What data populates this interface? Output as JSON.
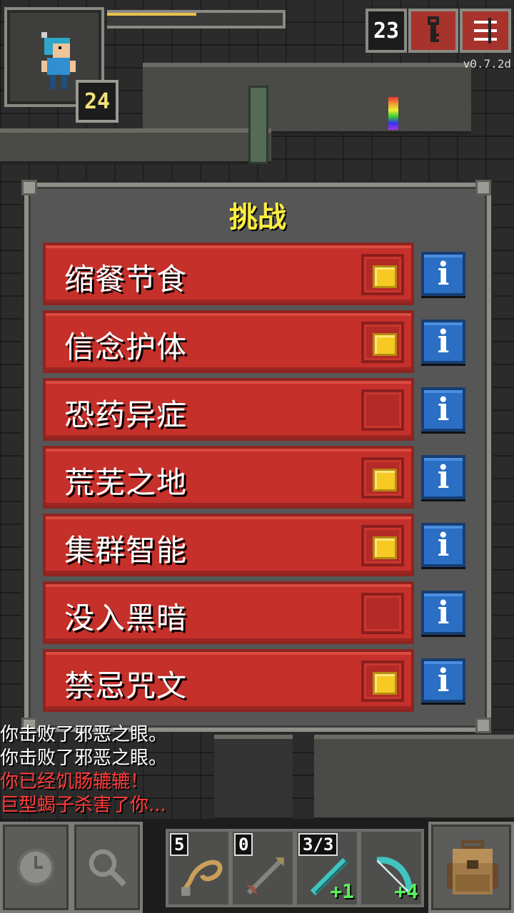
{
  "hud": {
    "hero_level": "24",
    "hp_fraction": 0.51,
    "depth": "23",
    "journal_icon": "key-icon",
    "menu_icon": "menu-icon",
    "version": "v0.7.2d"
  },
  "challenges": {
    "title": "挑战",
    "items": [
      {
        "label": "缩餐节食",
        "enabled": true
      },
      {
        "label": "信念护体",
        "enabled": true
      },
      {
        "label": "恐药异症",
        "enabled": false
      },
      {
        "label": "荒芜之地",
        "enabled": true
      },
      {
        "label": "集群智能",
        "enabled": true
      },
      {
        "label": "没入黑暗",
        "enabled": false
      },
      {
        "label": "禁忌咒文",
        "enabled": true
      }
    ],
    "info_label": "i"
  },
  "log": {
    "lines": [
      {
        "text": "你击败了邪恶之眼。",
        "color": "white"
      },
      {
        "text": "你击败了邪恶之眼。",
        "color": "white"
      },
      {
        "text": "你已经饥肠辘辘！",
        "color": "red"
      },
      {
        "text": "巨型蝎子杀害了你...",
        "color": "red"
      }
    ]
  },
  "toolbar": {
    "wait_icon": "clock-icon",
    "search_icon": "magnifier-icon",
    "quickslots": [
      {
        "icon": "whip-icon",
        "count": "5",
        "level": ""
      },
      {
        "icon": "dart-icon",
        "count": "0",
        "level": ""
      },
      {
        "icon": "wand-icon",
        "count": "3/3",
        "level": "+1"
      },
      {
        "icon": "bow-icon",
        "count": "",
        "level": "+4"
      }
    ],
    "backpack_icon": "backpack-icon"
  }
}
